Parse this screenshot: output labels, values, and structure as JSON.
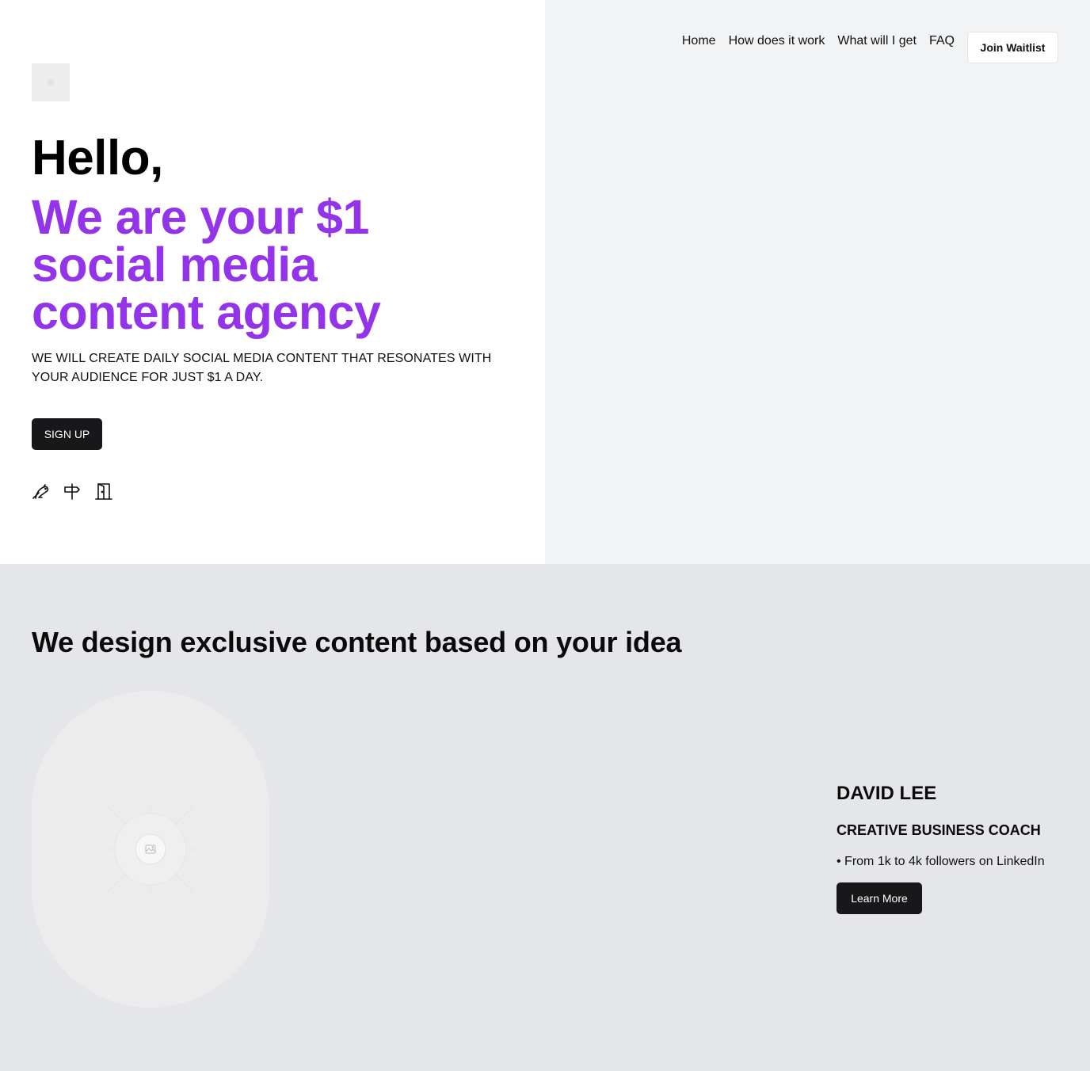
{
  "nav": {
    "links": [
      "Home",
      "How does it work",
      "What will I get",
      "FAQ"
    ],
    "cta": "Join Waitlist"
  },
  "hero": {
    "greeting": "Hello,",
    "headline": "We are your $1 social media content agency",
    "subtitle": "WE WILL CREATE DAILY SOCIAL MEDIA CONTENT THAT RESONATES WITH YOUR AUDIENCE FOR JUST $1 A DAY.",
    "signup_label": "SIGN UP",
    "social_icons": [
      "bird-icon",
      "signpost-icon",
      "door-icon"
    ],
    "headline_color": "#9333ea"
  },
  "feature": {
    "title": "We design exclusive content based on your idea",
    "image_icon": "image-placeholder-icon",
    "person": {
      "name": "DAVID LEE",
      "role": "CREATIVE BUSINESS COACH",
      "bullet": "• From 1k to 4k followers on LinkedIn",
      "button": "Learn More"
    }
  },
  "colors": {
    "accent": "#9333ea",
    "button_dark": "#18181b",
    "hero_right_bg": "#f2f3f5",
    "section_bg": "#e5e6e9"
  }
}
